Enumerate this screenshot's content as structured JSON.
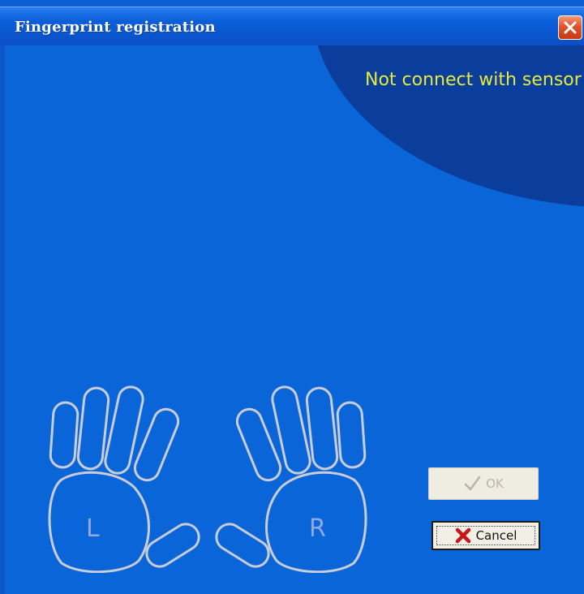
{
  "window": {
    "title": "Fingerprint registration"
  },
  "status": {
    "message": "Not connect with sensor",
    "color": "#e6ea3a"
  },
  "hands": {
    "left_label": "L",
    "right_label": "R"
  },
  "buttons": {
    "ok_label": "OK",
    "ok_icon": "check-icon",
    "ok_enabled": false,
    "cancel_label": "Cancel",
    "cancel_icon": "red-x-icon"
  },
  "colors": {
    "background": "#0a66d8",
    "titlebar": "#0a56cf",
    "dark_region": "#0a3d9c",
    "hand_outline": "#c8cdd8"
  }
}
